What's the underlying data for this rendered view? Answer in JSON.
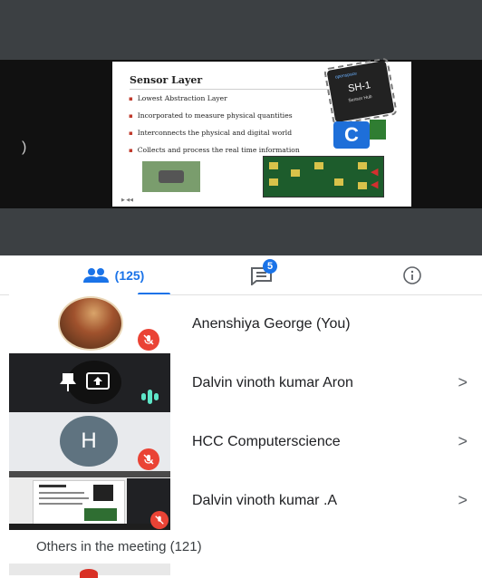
{
  "colors": {
    "accent": "#1a73e8",
    "mute_red": "#ea4335",
    "speaking_teal": "#5ee6c8",
    "stage_dark": "#3c4043"
  },
  "stage": {
    "prev_icon": "chevron-left",
    "slide": {
      "title": "Sensor Layer",
      "bullets": [
        "Lowest Abstraction Layer",
        "Incorporated to measure physical quantities",
        "Interconnects the physical and digital world",
        "Collects and process the real time information"
      ],
      "chip_brand": "openspace",
      "chip_name": "SH-1",
      "chip_sub": "Sensor Hub",
      "footer": "▶ ◀◀"
    }
  },
  "tabs": {
    "people": {
      "icon": "people-icon",
      "count": "(125)"
    },
    "chat": {
      "icon": "chat-icon",
      "badge": "5"
    },
    "info": {
      "icon": "info-icon"
    }
  },
  "participants": [
    {
      "name": "Anenshiya George (You)",
      "muted": true,
      "has_chevron": false
    },
    {
      "name": "Dalvin vinoth kumar Aron",
      "muted": false,
      "speaking": true,
      "has_chevron": true,
      "chevron": ">"
    },
    {
      "name": "HCC Computerscience",
      "muted": true,
      "avatar_letter": "H",
      "has_chevron": true,
      "chevron": ">"
    },
    {
      "name": "Dalvin vinoth kumar .A",
      "muted": true,
      "has_chevron": true,
      "chevron": ">"
    }
  ],
  "others": {
    "label": "Others in the meeting (121)"
  }
}
